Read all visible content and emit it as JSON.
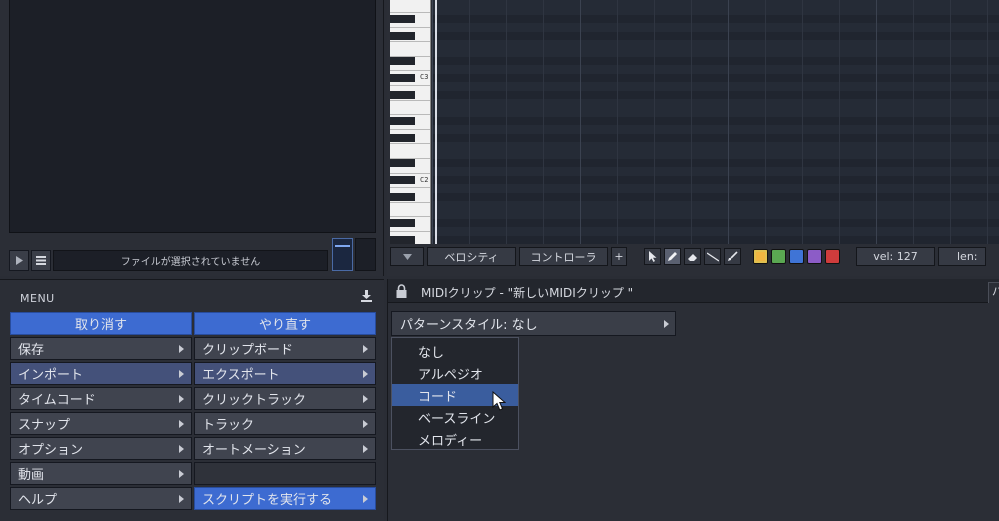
{
  "browser": {
    "status_text": "ファイルが選択されていません",
    "play_icon": "play-icon",
    "list_icon": "list-icon"
  },
  "piano_roll": {
    "key_labels": [
      "C3",
      "C2"
    ],
    "toolbar": {
      "velocity_label": "ベロシティ",
      "controller_label": "コントローラ",
      "add_label": "+",
      "vel_readout": "vel: 127",
      "len_readout": "len:"
    },
    "tools": [
      "pointer-tool-icon",
      "pencil-tool-icon",
      "eraser-tool-icon",
      "line-tool-icon",
      "brush-tool-icon"
    ],
    "colors": [
      "#f0b541",
      "#5aa852",
      "#3f74d6",
      "#8c5cc7",
      "#cf3c3c"
    ]
  },
  "menu": {
    "title": "MENU",
    "undo": "取り消す",
    "redo": "やり直す",
    "left": [
      "保存",
      "インポート",
      "タイムコード",
      "スナップ",
      "オプション",
      "動画",
      "ヘルプ"
    ],
    "right": [
      "クリップボード",
      "エクスポート",
      "クリックトラック",
      "トラック",
      "オートメーション",
      "",
      "スクリプトを実行する"
    ]
  },
  "clip": {
    "title": "MIDIクリップ - \"新しいMIDIクリップ \"",
    "tab_stub": "パ",
    "pattern_style": "パターンスタイル: なし",
    "options": [
      "なし",
      "アルペジオ",
      "コード",
      "ベースライン",
      "メロディー"
    ],
    "highlighted_option": "コード"
  },
  "colors": {
    "accent": "#3d6bd1",
    "panel": "#2b2e36"
  }
}
